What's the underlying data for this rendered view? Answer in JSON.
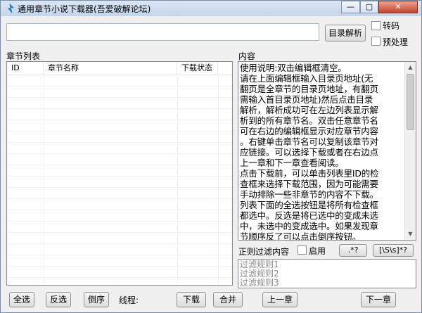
{
  "window": {
    "title": "通用章节小说下载器(吾爱破解论坛)"
  },
  "controls": {
    "minimize": "—",
    "maximize": "▢",
    "close": "✕"
  },
  "top": {
    "url_value": "",
    "parse_button": "目录解析",
    "transcode_label": "转码",
    "preprocess_label": "预处理"
  },
  "chapters": {
    "section_label": "章节列表",
    "columns": [
      "ID",
      "章节名称",
      "下载状态"
    ],
    "rows": []
  },
  "content": {
    "section_label": "内容",
    "lines": [
      "使用说明:双击编辑框清空。",
      "请在上面编辑框输入目录页地址(无",
      "翻页是全章节的目录页地址，有翻页",
      "需输入首目录页地址)然后点击目录",
      "解析，解析成功可在左边列表显示解",
      "析到的所有章节名。双击任意章节名",
      "可在右边的编辑框显示对应章节内容",
      "。右键单击章节名可以复制该章节对",
      "应链接。可以选择下载或者在右边点",
      "上一章和下一章查看阅读。",
      "点击下载前，可以单击列表里ID的检",
      "查框来选择下载范围，因为可能需要",
      "手动排除一些非章节的内容不下载。",
      "列表下面的全选按钮是将所有检查框",
      "都选中。反选是将已选中的变成未选",
      "中，未选中的变成选中。如果发现章",
      "节顺序反了可以点击倒序按钮。"
    ]
  },
  "filter": {
    "label": "正则过滤内容",
    "enable_label": "启用",
    "pattern1": ".*?",
    "pattern2": "[\\S\\s]*?",
    "rules": [
      "过滤规则1",
      "过滤规则2",
      "过滤规则3"
    ]
  },
  "bottom": {
    "select_all": "全选",
    "invert": "反选",
    "reverse": "倒序",
    "threads_label": "线程:",
    "download": "下载",
    "merge": "合并",
    "prev": "上一章",
    "next": "下一章"
  }
}
